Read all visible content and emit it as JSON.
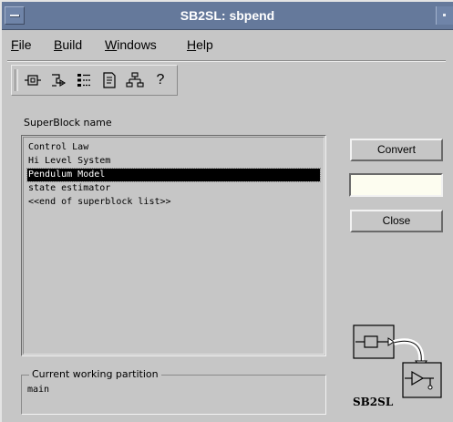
{
  "window": {
    "title": "SB2SL: sbpend"
  },
  "menu": {
    "file": {
      "mnemonic": "F",
      "rest": "ile"
    },
    "build": {
      "mnemonic": "B",
      "rest": "uild"
    },
    "windows": {
      "mnemonic": "W",
      "rest": "indows"
    },
    "help": {
      "mnemonic": "H",
      "rest": "elp"
    }
  },
  "toolbar": {
    "icons": [
      "superblock-icon",
      "build-icon",
      "list-icon",
      "document-icon",
      "hierarchy-icon",
      "help-icon"
    ],
    "help_glyph": "?"
  },
  "superblock": {
    "label": "SuperBlock name",
    "items": [
      "Control Law",
      "Hi Level System",
      "Pendulum Model",
      "state estimator",
      "<<end of superblock list>>"
    ],
    "selected_index": 2
  },
  "buttons": {
    "convert": "Convert",
    "close": "Close"
  },
  "output_field": {
    "value": ""
  },
  "partition": {
    "label": "Current working partition",
    "value": "main"
  },
  "logo": {
    "text": "SB2SL"
  },
  "colors": {
    "titlebar": "#65799b",
    "window_bg": "#c6c6c6",
    "field_bg": "#fdfdf0",
    "selection_bg": "#000000"
  }
}
